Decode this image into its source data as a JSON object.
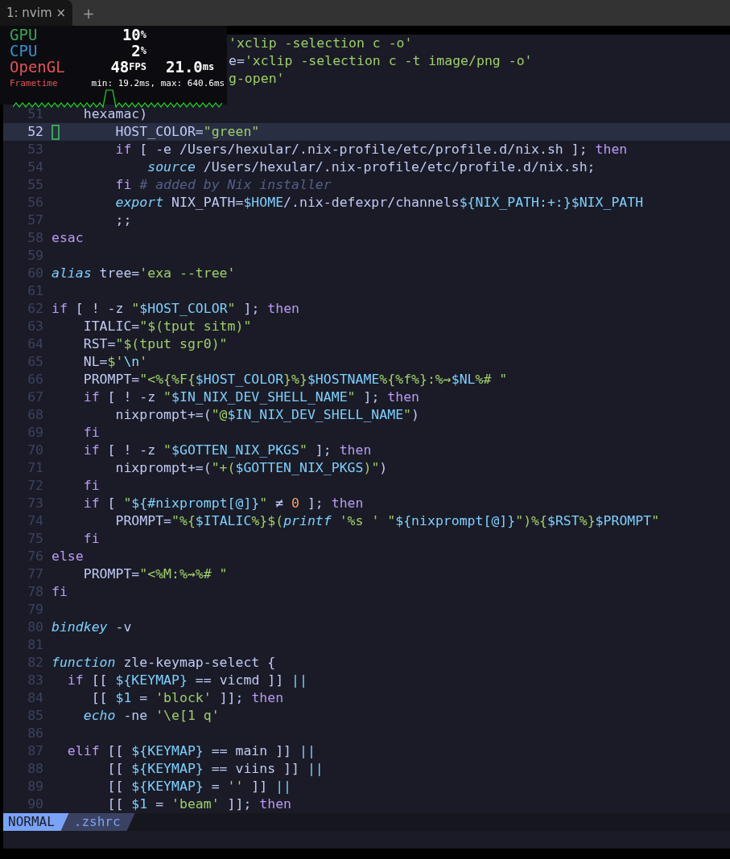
{
  "tabs": [
    {
      "label": "1: nvim",
      "close": "×",
      "selected": true
    }
  ],
  "new_tab": "+",
  "perf_overlay": {
    "rows": [
      {
        "label": "GPU",
        "color": "#3aa35a",
        "value": "10",
        "unit": "%"
      },
      {
        "label": "CPU",
        "color": "#3a8fd0",
        "value": "2",
        "unit": "%"
      },
      {
        "label": "OpenGL",
        "color": "#e05555",
        "value": "48",
        "unit": "FPS",
        "value2": "21.0",
        "unit2": "ms"
      }
    ],
    "frametime_label": "Frametime",
    "frametime_stats": "min: 19.2ms, max: 640.6ms"
  },
  "lines_behind_overlay": [
    {
      "tokens": [
        {
          "kind": "string",
          "text": "'xclip -selection c -o'"
        }
      ]
    },
    {
      "tokens": [
        {
          "kind": "plain",
          "text": "e="
        },
        {
          "kind": "string",
          "text": "'xclip -selection c -t image/png -o'"
        }
      ]
    },
    {
      "tokens": [
        {
          "kind": "string",
          "text": "g-open'"
        }
      ]
    }
  ],
  "lines": [
    {
      "number": "51",
      "current": false,
      "tokens": [
        {
          "kind": "plain",
          "text": "    hexamac)"
        }
      ]
    },
    {
      "number": "52",
      "current": true,
      "tokens": [
        {
          "kind": "plain",
          "text": "        HOST_COLOR="
        },
        {
          "kind": "string",
          "text": "\"green\""
        }
      ]
    },
    {
      "number": "53",
      "current": false,
      "tokens": [
        {
          "kind": "keyword",
          "text": "        if"
        },
        {
          "kind": "plain",
          "text": " [ -e /Users/hexular/.nix-profile/etc/profile.d/nix.sh ]; "
        },
        {
          "kind": "keyword",
          "text": "then"
        }
      ]
    },
    {
      "number": "54",
      "current": false,
      "tokens": [
        {
          "kind": "builtin",
          "text": "            source"
        },
        {
          "kind": "plain",
          "text": " /Users/hexular/.nix-profile/etc/profile.d/nix.sh;"
        }
      ]
    },
    {
      "number": "55",
      "current": false,
      "tokens": [
        {
          "kind": "keyword",
          "text": "        fi"
        },
        {
          "kind": "comment",
          "text": " # added by Nix installer"
        }
      ]
    },
    {
      "number": "56",
      "current": false,
      "tokens": [
        {
          "kind": "builtin",
          "text": "        export"
        },
        {
          "kind": "plain",
          "text": " NIX_PATH="
        },
        {
          "kind": "variable",
          "text": "$HOME"
        },
        {
          "kind": "plain",
          "text": "/.nix-defexpr/channels"
        },
        {
          "kind": "variable",
          "text": "${NIX_PATH:+:}$NIX_PATH"
        }
      ]
    },
    {
      "number": "57",
      "current": false,
      "tokens": [
        {
          "kind": "plain",
          "text": "        ;;"
        }
      ]
    },
    {
      "number": "58",
      "current": false,
      "tokens": [
        {
          "kind": "keyword",
          "text": "esac"
        }
      ]
    },
    {
      "number": "59",
      "current": false
    },
    {
      "number": "60",
      "current": false,
      "tokens": [
        {
          "kind": "builtin",
          "text": "alias"
        },
        {
          "kind": "plain",
          "text": " tree="
        },
        {
          "kind": "string",
          "text": "'exa --tree'"
        }
      ]
    },
    {
      "number": "61",
      "current": false
    },
    {
      "number": "62",
      "current": false,
      "tokens": [
        {
          "kind": "keyword",
          "text": "if"
        },
        {
          "kind": "plain",
          "text": " [ ! -z "
        },
        {
          "kind": "string",
          "text": "\""
        },
        {
          "kind": "variable",
          "text": "$HOST_COLOR"
        },
        {
          "kind": "string",
          "text": "\""
        },
        {
          "kind": "plain",
          "text": " ]; "
        },
        {
          "kind": "keyword",
          "text": "then"
        }
      ]
    },
    {
      "number": "63",
      "current": false,
      "tokens": [
        {
          "kind": "plain",
          "text": "    ITALIC="
        },
        {
          "kind": "string",
          "text": "\"$(tput sitm)\""
        }
      ]
    },
    {
      "number": "64",
      "current": false,
      "tokens": [
        {
          "kind": "plain",
          "text": "    RST="
        },
        {
          "kind": "string",
          "text": "\"$(tput sgr0)\""
        }
      ]
    },
    {
      "number": "65",
      "current": false,
      "tokens": [
        {
          "kind": "plain",
          "text": "    NL="
        },
        {
          "kind": "string",
          "text": "$'"
        },
        {
          "kind": "escape",
          "text": "\\n"
        },
        {
          "kind": "string",
          "text": "'"
        }
      ]
    },
    {
      "number": "66",
      "current": false,
      "tokens": [
        {
          "kind": "plain",
          "text": "    PROMPT="
        },
        {
          "kind": "string",
          "text": "\"<%{%F{"
        },
        {
          "kind": "variable",
          "text": "$HOST_COLOR"
        },
        {
          "kind": "string",
          "text": "}%}"
        },
        {
          "kind": "variable",
          "text": "$HOSTNAME"
        },
        {
          "kind": "string",
          "text": "%{%f%}:%⇝"
        },
        {
          "kind": "variable",
          "text": "$NL"
        },
        {
          "kind": "string",
          "text": "%# \""
        }
      ]
    },
    {
      "number": "67",
      "current": false,
      "tokens": [
        {
          "kind": "keyword",
          "text": "    if"
        },
        {
          "kind": "plain",
          "text": " [ ! -z "
        },
        {
          "kind": "string",
          "text": "\""
        },
        {
          "kind": "variable",
          "text": "$IN_NIX_DEV_SHELL_NAME"
        },
        {
          "kind": "string",
          "text": "\""
        },
        {
          "kind": "plain",
          "text": " ]; "
        },
        {
          "kind": "keyword",
          "text": "then"
        }
      ]
    },
    {
      "number": "68",
      "current": false,
      "tokens": [
        {
          "kind": "plain",
          "text": "        nixprompt+=("
        },
        {
          "kind": "string",
          "text": "\"@"
        },
        {
          "kind": "variable",
          "text": "$IN_NIX_DEV_SHELL_NAME"
        },
        {
          "kind": "string",
          "text": "\""
        },
        {
          "kind": "plain",
          "text": ")"
        }
      ]
    },
    {
      "number": "69",
      "current": false,
      "tokens": [
        {
          "kind": "keyword",
          "text": "    fi"
        }
      ]
    },
    {
      "number": "70",
      "current": false,
      "tokens": [
        {
          "kind": "keyword",
          "text": "    if"
        },
        {
          "kind": "plain",
          "text": " [ ! -z "
        },
        {
          "kind": "string",
          "text": "\""
        },
        {
          "kind": "variable",
          "text": "$GOTTEN_NIX_PKGS"
        },
        {
          "kind": "string",
          "text": "\""
        },
        {
          "kind": "plain",
          "text": " ]; "
        },
        {
          "kind": "keyword",
          "text": "then"
        }
      ]
    },
    {
      "number": "71",
      "current": false,
      "tokens": [
        {
          "kind": "plain",
          "text": "        nixprompt+=("
        },
        {
          "kind": "string",
          "text": "\"+("
        },
        {
          "kind": "variable",
          "text": "$GOTTEN_NIX_PKGS"
        },
        {
          "kind": "string",
          "text": ")\""
        },
        {
          "kind": "plain",
          "text": ")"
        }
      ]
    },
    {
      "number": "72",
      "current": false,
      "tokens": [
        {
          "kind": "keyword",
          "text": "    fi"
        }
      ]
    },
    {
      "number": "73",
      "current": false,
      "tokens": [
        {
          "kind": "keyword",
          "text": "    if"
        },
        {
          "kind": "plain",
          "text": " [ "
        },
        {
          "kind": "string",
          "text": "\""
        },
        {
          "kind": "variable",
          "text": "${#nixprompt[@]}"
        },
        {
          "kind": "string",
          "text": "\""
        },
        {
          "kind": "plain",
          "text": " ≠ "
        },
        {
          "kind": "number",
          "text": "0"
        },
        {
          "kind": "plain",
          "text": " ]; "
        },
        {
          "kind": "keyword",
          "text": "then"
        }
      ]
    },
    {
      "number": "74",
      "current": false,
      "tokens": [
        {
          "kind": "plain",
          "text": "        PROMPT="
        },
        {
          "kind": "string",
          "text": "\"%{"
        },
        {
          "kind": "variable",
          "text": "$ITALIC"
        },
        {
          "kind": "string",
          "text": "%}$("
        },
        {
          "kind": "builtin",
          "text": "printf"
        },
        {
          "kind": "string",
          "text": " '%s ' \""
        },
        {
          "kind": "variable",
          "text": "${nixprompt[@]}"
        },
        {
          "kind": "string",
          "text": "\")%{"
        },
        {
          "kind": "variable",
          "text": "$RST"
        },
        {
          "kind": "string",
          "text": "%}"
        },
        {
          "kind": "variable",
          "text": "$PROMPT"
        },
        {
          "kind": "string",
          "text": "\""
        }
      ]
    },
    {
      "number": "75",
      "current": false,
      "tokens": [
        {
          "kind": "keyword",
          "text": "    fi"
        }
      ]
    },
    {
      "number": "76",
      "current": false,
      "tokens": [
        {
          "kind": "keyword",
          "text": "else"
        }
      ]
    },
    {
      "number": "77",
      "current": false,
      "tokens": [
        {
          "kind": "plain",
          "text": "    PROMPT="
        },
        {
          "kind": "string",
          "text": "\"<%M:%⇝%# \""
        }
      ]
    },
    {
      "number": "78",
      "current": false,
      "tokens": [
        {
          "kind": "keyword",
          "text": "fi"
        }
      ]
    },
    {
      "number": "79",
      "current": false
    },
    {
      "number": "80",
      "current": false,
      "tokens": [
        {
          "kind": "builtin",
          "text": "bindkey"
        },
        {
          "kind": "plain",
          "text": " -v"
        }
      ]
    },
    {
      "number": "81",
      "current": false
    },
    {
      "number": "82",
      "current": false,
      "tokens": [
        {
          "kind": "builtin",
          "text": "function"
        },
        {
          "kind": "plain",
          "text": " zle-keymap-select {"
        }
      ]
    },
    {
      "number": "83",
      "current": false,
      "tokens": [
        {
          "kind": "keyword",
          "text": "  if"
        },
        {
          "kind": "plain",
          "text": " [[ "
        },
        {
          "kind": "variable",
          "text": "${KEYMAP}"
        },
        {
          "kind": "plain",
          "text": " == vicmd ]] "
        },
        {
          "kind": "operator",
          "text": "||"
        }
      ]
    },
    {
      "number": "84",
      "current": false,
      "tokens": [
        {
          "kind": "plain",
          "text": "     [[ "
        },
        {
          "kind": "variable",
          "text": "$1"
        },
        {
          "kind": "plain",
          "text": " = "
        },
        {
          "kind": "string",
          "text": "'block'"
        },
        {
          "kind": "plain",
          "text": " ]]; "
        },
        {
          "kind": "keyword",
          "text": "then"
        }
      ]
    },
    {
      "number": "85",
      "current": false,
      "tokens": [
        {
          "kind": "builtin",
          "text": "    echo"
        },
        {
          "kind": "plain",
          "text": " -ne "
        },
        {
          "kind": "string",
          "text": "'\\e[1 q'"
        }
      ]
    },
    {
      "number": "86",
      "current": false
    },
    {
      "number": "87",
      "current": false,
      "tokens": [
        {
          "kind": "keyword",
          "text": "  elif"
        },
        {
          "kind": "plain",
          "text": " [[ "
        },
        {
          "kind": "variable",
          "text": "${KEYMAP}"
        },
        {
          "kind": "plain",
          "text": " == main ]] "
        },
        {
          "kind": "operator",
          "text": "||"
        }
      ]
    },
    {
      "number": "88",
      "current": false,
      "tokens": [
        {
          "kind": "plain",
          "text": "       [[ "
        },
        {
          "kind": "variable",
          "text": "${KEYMAP}"
        },
        {
          "kind": "plain",
          "text": " == viins ]] "
        },
        {
          "kind": "operator",
          "text": "||"
        }
      ]
    },
    {
      "number": "89",
      "current": false,
      "tokens": [
        {
          "kind": "plain",
          "text": "       [[ "
        },
        {
          "kind": "variable",
          "text": "${KEYMAP}"
        },
        {
          "kind": "plain",
          "text": " = "
        },
        {
          "kind": "string",
          "text": "''"
        },
        {
          "kind": "plain",
          "text": " ]] "
        },
        {
          "kind": "operator",
          "text": "||"
        }
      ]
    },
    {
      "number": "90",
      "current": false,
      "tokens": [
        {
          "kind": "plain",
          "text": "       [[ "
        },
        {
          "kind": "variable",
          "text": "$1"
        },
        {
          "kind": "plain",
          "text": " = "
        },
        {
          "kind": "string",
          "text": "'beam'"
        },
        {
          "kind": "plain",
          "text": " ]]; "
        },
        {
          "kind": "keyword",
          "text": "then"
        }
      ]
    }
  ],
  "status_bar": {
    "mode": "NORMAL",
    "file": ".zshrc"
  }
}
